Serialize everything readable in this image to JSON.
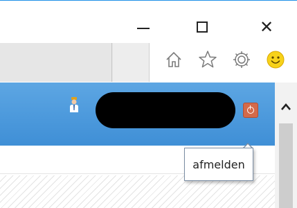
{
  "window_controls": {
    "minimize_icon": "minimize-icon",
    "maximize_icon": "maximize-icon",
    "close_icon": "close-icon",
    "close_glyph": "✕"
  },
  "toolbar": {
    "icons": [
      "home-icon",
      "star-icon",
      "gear-icon",
      "smiley-icon"
    ]
  },
  "site_header": {
    "background_color": "#4a98dc",
    "user_name": "",
    "logout_tooltip": "afmelden"
  },
  "colors": {
    "logout_button": "#d46a4a",
    "window_accent": "#1e90e8"
  }
}
